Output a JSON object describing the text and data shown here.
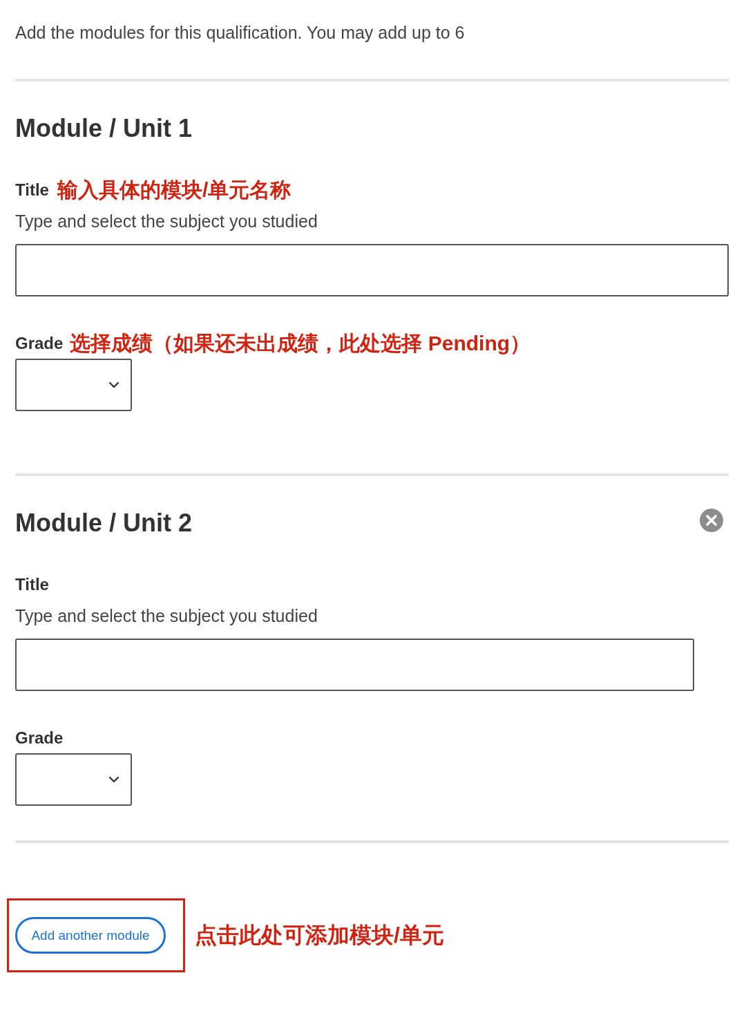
{
  "intro": "Add the modules for this qualification. You may add up to 6",
  "modules": [
    {
      "heading": "Module / Unit 1",
      "removable": false,
      "title_field": {
        "label": "Title",
        "annotation": "输入具体的模块/单元名称",
        "hint": "Type and select the subject you studied"
      },
      "grade_field": {
        "label": "Grade",
        "annotation": "选择成绩（如果还未出成绩，此处选择 Pending）"
      }
    },
    {
      "heading": "Module / Unit 2",
      "removable": true,
      "title_field": {
        "label": "Title",
        "hint": "Type and select the subject you studied"
      },
      "grade_field": {
        "label": "Grade"
      }
    }
  ],
  "add_module": {
    "label": "Add another module",
    "highlighted": true,
    "annotation": "点击此处可添加模块/单元"
  }
}
